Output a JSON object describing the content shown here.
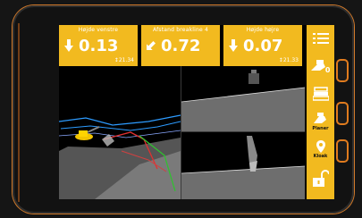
{
  "tiles": [
    {
      "title": "Højde venstre",
      "value": "0.13",
      "sub": "21.34",
      "arrow": "down"
    },
    {
      "title": "Afstand breakline 4",
      "value": "0.72",
      "sub": "",
      "arrow": "down-left"
    },
    {
      "title": "Højde højre",
      "value": "0.07",
      "sub": "21.33",
      "arrow": "down"
    }
  ],
  "sidebar": {
    "items": [
      {
        "icon": "menu-icon",
        "label": ""
      },
      {
        "icon": "excavator-zero-icon",
        "label": "0"
      },
      {
        "icon": "stack-icon",
        "label": ""
      },
      {
        "icon": "planer-icon",
        "label": "Planer"
      },
      {
        "icon": "location-pin-icon",
        "label": "Kloak"
      },
      {
        "icon": "unlock-icon",
        "label": ""
      }
    ]
  },
  "colors": {
    "accent": "#f2ba1f",
    "device_frame": "#d27a2a",
    "background": "#000000"
  }
}
